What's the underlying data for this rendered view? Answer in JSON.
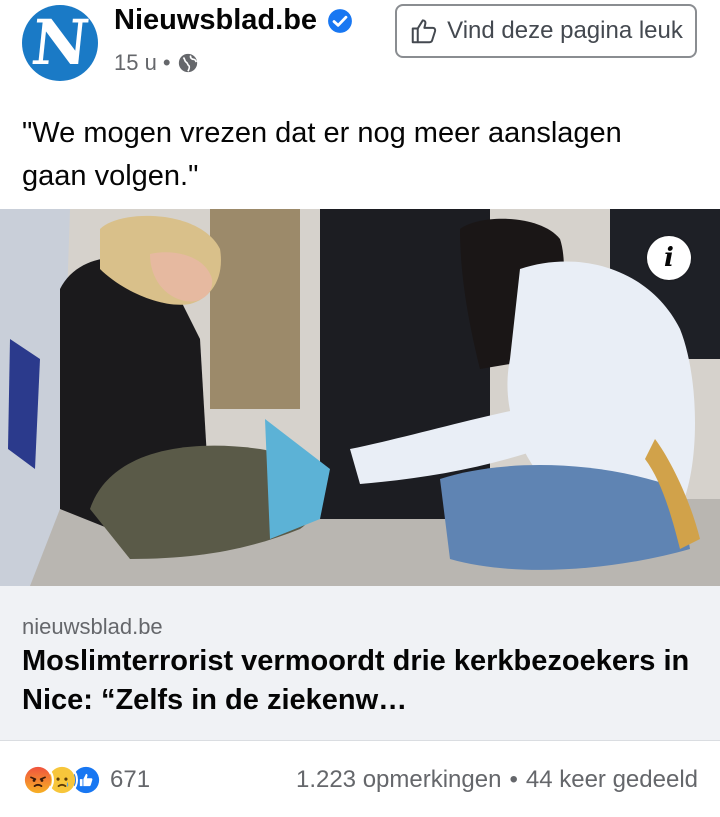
{
  "page": {
    "name": "Nieuwsblad.be",
    "logo_letter": "N",
    "time": "15 u",
    "separator": "•",
    "verified_icon": "verified-badge-icon",
    "audience_icon": "globe-icon"
  },
  "like_button": {
    "label": "Vind deze pagina leuk",
    "icon": "thumbs-up-outline-icon"
  },
  "post": {
    "text": "\"We mogen vrezen dat er nog meer aanslagen gaan volgen.\""
  },
  "link_preview": {
    "domain": "nieuwsblad.be",
    "title": "Moslimterrorist vermoordt drie kerkbezoekers in Nice: “Zelfs in de ziekenw…",
    "info_label": "i"
  },
  "stats": {
    "reactions": [
      "angry",
      "sad",
      "like"
    ],
    "reaction_count": "671",
    "comments": "1.223 opmerkingen",
    "separator": "•",
    "shares": "44 keer gedeeld"
  },
  "colors": {
    "brand_blue": "#1a7ac6",
    "facebook_blue": "#1877f2",
    "link_bg": "#f0f2f5",
    "secondary_text": "#65676b"
  }
}
